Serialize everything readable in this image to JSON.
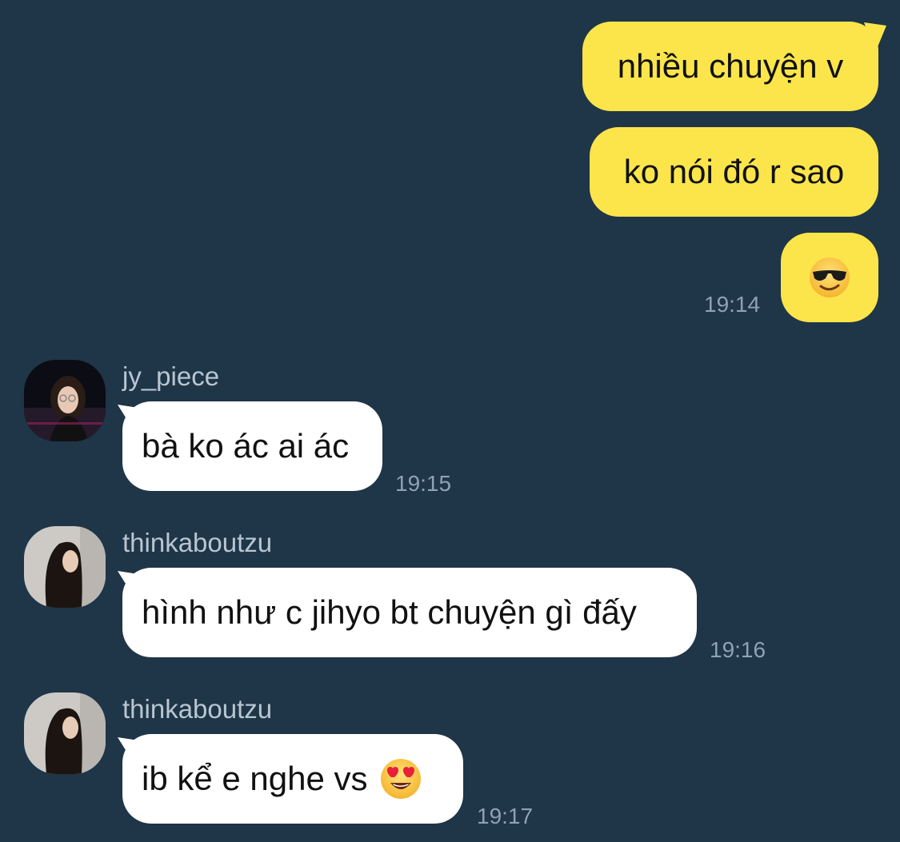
{
  "colors": {
    "background": "#1f3548",
    "outgoing_bubble": "#fbe54a",
    "incoming_bubble": "#ffffff",
    "timestamp": "#8ea2b3",
    "username": "#b8c6d2"
  },
  "outgoing": {
    "messages": [
      {
        "text": "nhiều chuyện v"
      },
      {
        "text": "ko nói đó r sao"
      },
      {
        "text": "",
        "icon": "sunglasses-face-emoji"
      }
    ],
    "time": "19:14"
  },
  "incoming": [
    {
      "username": "jy_piece",
      "avatar": "user-avatar-photo",
      "text": "bà ko ác ai ác",
      "time": "19:15"
    },
    {
      "username": "thinkaboutzu",
      "avatar": "user-avatar-photo",
      "text": "hình như c jihyo bt chuyện gì đấy",
      "time": "19:16"
    },
    {
      "username": "thinkaboutzu",
      "avatar": "user-avatar-photo",
      "text": "ib kể e nghe vs",
      "icon": "heart-eyes-emoji",
      "time": "19:17"
    }
  ]
}
